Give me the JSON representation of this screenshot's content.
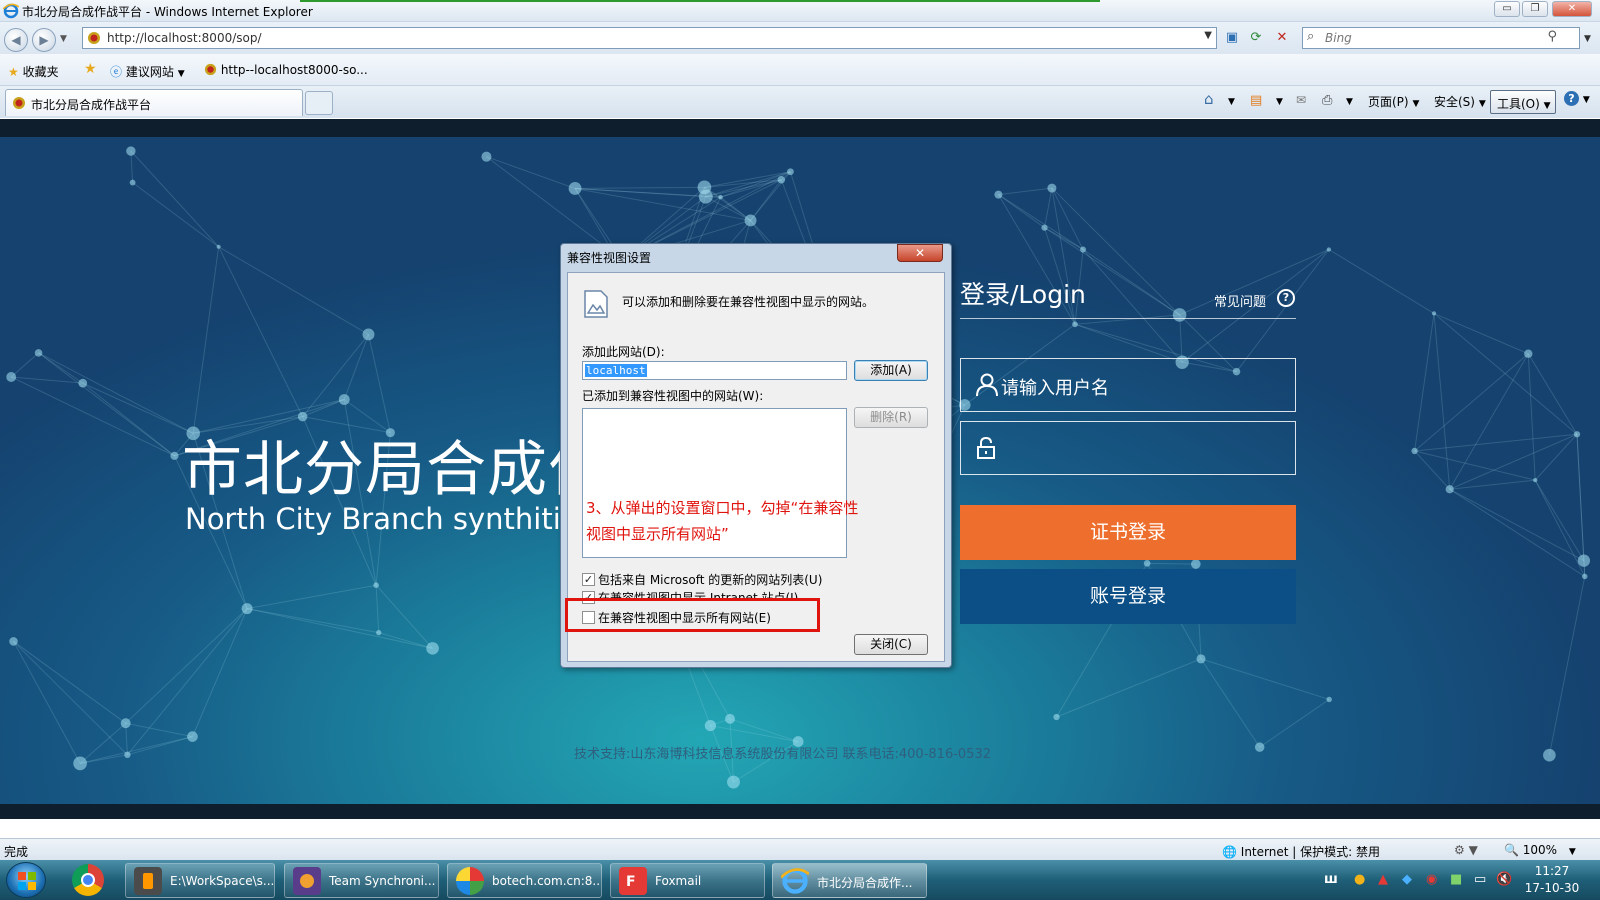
{
  "window": {
    "title": "市北分局合成作战平台 - Windows Internet Explorer",
    "minimize": "▭",
    "restore": "❐",
    "close": "✕"
  },
  "address": {
    "url": "http://localhost:8000/sop/",
    "search_placeholder": "Bing"
  },
  "favorites": {
    "label": "收藏夹",
    "suggested": "建议网站",
    "link": "http--localhost8000-so..."
  },
  "tabs": [
    {
      "label": "市北分局合成作战平台"
    }
  ],
  "commands": {
    "page": "页面(P)",
    "safety": "安全(S)",
    "tools": "工具(O)"
  },
  "page": {
    "brand_cn": "市北分局合成作",
    "brand_en": "North City Branch synthitic b",
    "login_title": "登录/Login",
    "faq": "常见问题",
    "faq_icon": "?",
    "username_placeholder": "请输入用户名",
    "cert_login": "证书登录",
    "account_login": "账号登录",
    "footer": "技术支持:山东海博科技信息系统股份有限公司    联系电话:400-816-0532"
  },
  "dialog": {
    "title": "兼容性视图设置",
    "close": "✕",
    "description": "可以添加和删除要在兼容性视图中显示的网站。",
    "add_site_label": "添加此网站(D):",
    "add_site_value": "localhost",
    "add_button": "添加(A)",
    "list_label": "已添加到兼容性视图中的网站(W):",
    "remove_button": "删除(R)",
    "check1_label": "包括来自 Microsoft 的更新的网站列表(U)",
    "check1_checked": true,
    "check2_label": "在兼容性视图中显示 Intranet 站点(I)",
    "check2_checked": true,
    "check3_label": "在兼容性视图中显示所有网站(E)",
    "check3_checked": false,
    "close_button": "关闭(C)"
  },
  "annotation": {
    "text": "3、从弹出的设置窗口中，勾掉“在兼容性视图中显示所有网站”",
    "color": "#e0140e"
  },
  "status": {
    "left": "完成",
    "zone": "Internet | 保护模式: 禁用",
    "zoom": "100%"
  },
  "taskbar": {
    "tasks": [
      {
        "label": "E:\\WorkSpace\\s..."
      },
      {
        "label": "Team Synchroni..."
      },
      {
        "label": "botech.com.cn:8..."
      },
      {
        "label": "Foxmail"
      },
      {
        "label": "市北分局合成作..."
      }
    ],
    "time": "11:27",
    "date": "17-10-30"
  },
  "colors": {
    "cert_button": "#ee6f2d",
    "account_button": "#0b4f86",
    "background_teal": "#1b7f9c"
  }
}
